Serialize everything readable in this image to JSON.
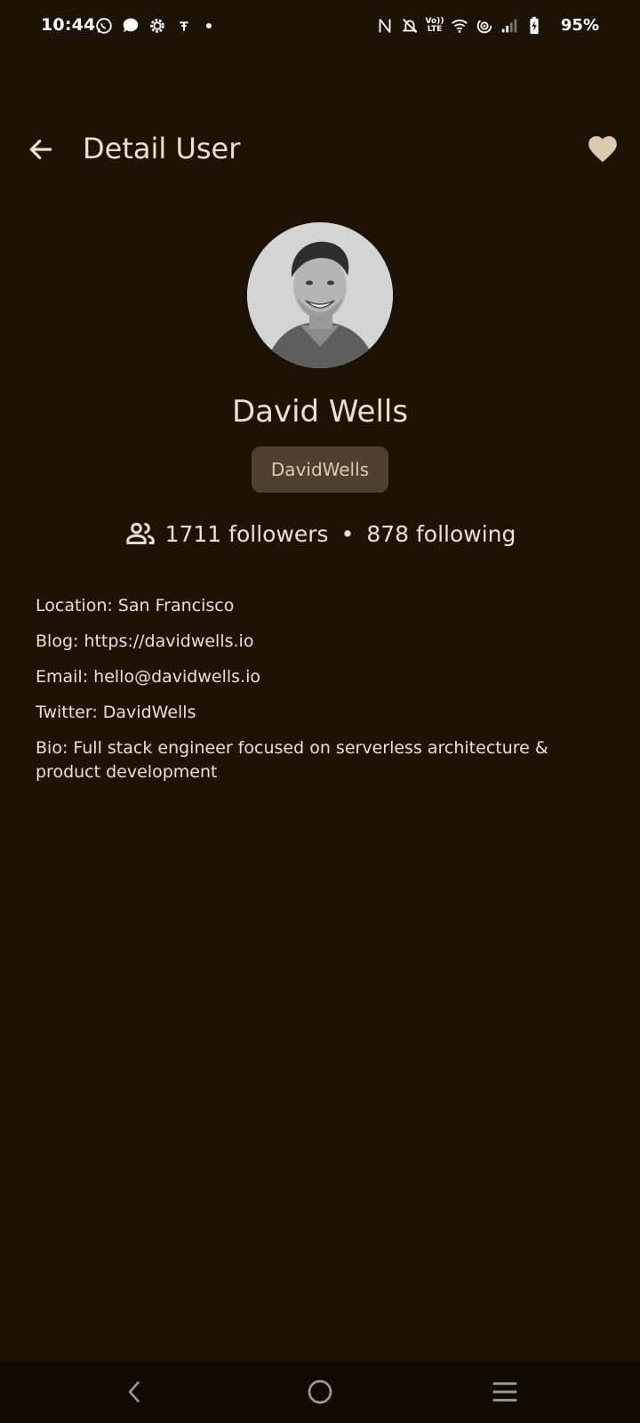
{
  "status_bar": {
    "time": "10:44",
    "battery": "95%",
    "volte_label_top": "Vo))",
    "volte_label_bottom": "LTE",
    "left_icons": [
      "whatsapp-icon",
      "chat-bubble-icon",
      "settings-gear-icon",
      "usb-icon",
      "dot-icon"
    ],
    "right_icons": [
      "nfc-icon",
      "bell-off-icon",
      "volte-icon",
      "wifi-icon",
      "hotspot-icon",
      "signal-icon",
      "battery-charging-icon"
    ]
  },
  "app_bar": {
    "title": "Detail User",
    "back_icon": "arrow-left-icon",
    "favorite_icon": "heart-icon"
  },
  "profile": {
    "name": "David Wells",
    "username": "DavidWells",
    "followers": "1711 followers",
    "separator": "•",
    "following": "878 following"
  },
  "details": {
    "location": "Location: San Francisco",
    "blog": "Blog: https://davidwells.io",
    "email": "Email: hello@davidwells.io",
    "twitter": "Twitter: DavidWells",
    "bio": "Bio: Full stack engineer focused on serverless architecture & product development"
  },
  "nav_bar": {
    "icons": [
      "nav-back-icon",
      "nav-home-icon",
      "nav-recents-icon"
    ]
  },
  "colors": {
    "background": "#1c1306",
    "text": "#efe0c8",
    "chip": "#4d402e",
    "heart": "#dccab0",
    "nav_bar": "#110b03"
  }
}
